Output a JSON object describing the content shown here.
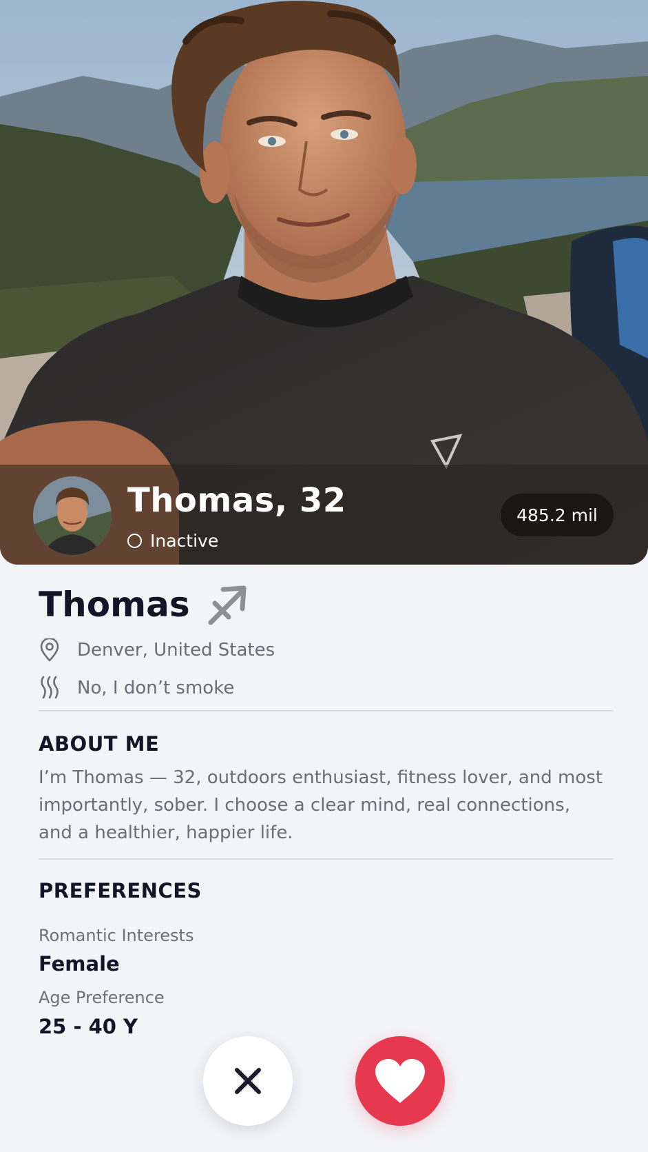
{
  "hero": {
    "name_age": "Thomas, 32",
    "status": "Inactive",
    "distance": "485.2 mil"
  },
  "profile": {
    "name": "Thomas",
    "zodiac_icon": "sagittarius-icon",
    "location": "Denver, United States",
    "smoking": "No, I don’t smoke"
  },
  "about": {
    "title": "ABOUT ME",
    "text": "I’m Thomas — 32, outdoors enthusiast, fitness lover, and most importantly, sober. I choose a clear mind, real connections, and a healthier, happier life."
  },
  "preferences": {
    "title": "PREFERENCES",
    "romantic_label": "Romantic Interests",
    "romantic_value": "Female",
    "age_label": "Age Preference",
    "age_value": "25 - 40 Y"
  },
  "actions": {
    "pass_icon": "close-icon",
    "like_icon": "heart-icon"
  },
  "colors": {
    "like": "#e6384f",
    "text_dark": "#141527",
    "text_muted": "#6b6d78",
    "background": "#f3f4f7"
  }
}
